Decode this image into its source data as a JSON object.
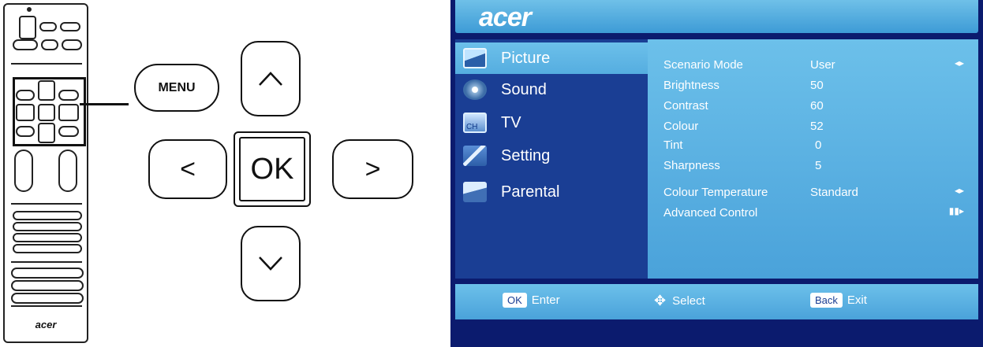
{
  "remote": {
    "logo": "acer"
  },
  "keys": {
    "menu": "MENU",
    "up": "^",
    "down": "v",
    "left": "<",
    "right": ">",
    "ok": "OK"
  },
  "osd": {
    "logo": "acer",
    "sidebar": [
      {
        "label": "Picture",
        "icon": "picture-icon"
      },
      {
        "label": "Sound",
        "icon": "sound-icon"
      },
      {
        "label": "TV",
        "icon": "tv-icon"
      },
      {
        "label": "Setting",
        "icon": "setting-icon"
      },
      {
        "label": "Parental",
        "icon": "parental-icon"
      }
    ],
    "tv_icon_text": "CH",
    "settings": [
      {
        "label": "Scenario Mode",
        "value": "User",
        "arrow": "◂▸"
      },
      {
        "label": "Brightness",
        "value": "50",
        "arrow": ""
      },
      {
        "label": "Contrast",
        "value": "60",
        "arrow": ""
      },
      {
        "label": "Colour",
        "value": "52",
        "arrow": ""
      },
      {
        "label": "Tint",
        "value": "0",
        "arrow": ""
      },
      {
        "label": "Sharpness",
        "value": "5",
        "arrow": ""
      },
      {
        "label": "Colour Temperature",
        "value": "Standard",
        "arrow": "◂▸"
      },
      {
        "label": "Advanced Control",
        "value": "",
        "arrow": "▮▮▸"
      }
    ],
    "footer": {
      "ok_tag": "OK",
      "ok_text": "Enter",
      "select_icon": "✥",
      "select_text": "Select",
      "back_tag": "Back",
      "back_text": "Exit"
    }
  }
}
